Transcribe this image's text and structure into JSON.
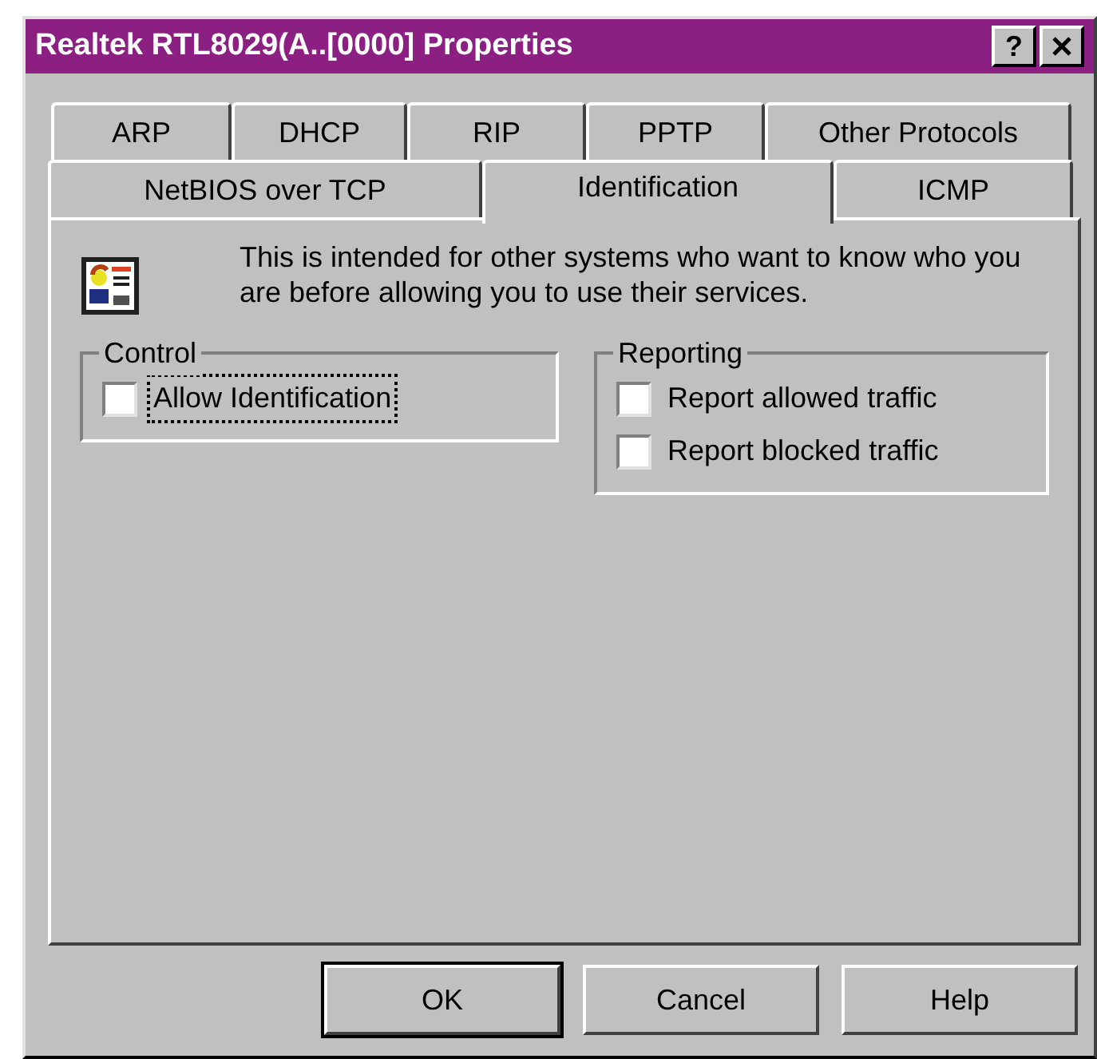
{
  "window": {
    "title": "Realtek RTL8029(A..[0000] Properties",
    "help_glyph": "?"
  },
  "tab_rows": [
    {
      "tabs": [
        {
          "label": "ARP",
          "selected": false
        },
        {
          "label": "DHCP",
          "selected": false
        },
        {
          "label": "RIP",
          "selected": false
        },
        {
          "label": "PPTP",
          "selected": false
        },
        {
          "label": "Other Protocols",
          "selected": false
        }
      ]
    },
    {
      "tabs": [
        {
          "label": "NetBIOS over TCP",
          "selected": false
        },
        {
          "label": "Identification",
          "selected": true
        },
        {
          "label": "ICMP",
          "selected": false
        }
      ]
    }
  ],
  "description": "This is intended for other systems who want to know who you are before allowing you to use their services.",
  "groups": [
    {
      "title": "Control",
      "checkboxes": [
        {
          "label": "Allow Identification",
          "checked": false,
          "focused": true
        }
      ]
    },
    {
      "title": "Reporting",
      "checkboxes": [
        {
          "label": "Report allowed traffic",
          "checked": false,
          "focused": false
        },
        {
          "label": "Report blocked traffic",
          "checked": false,
          "focused": false
        }
      ]
    }
  ],
  "buttons": [
    {
      "label": "OK",
      "default": true
    },
    {
      "label": "Cancel",
      "default": false
    },
    {
      "label": "Help",
      "default": false
    }
  ]
}
